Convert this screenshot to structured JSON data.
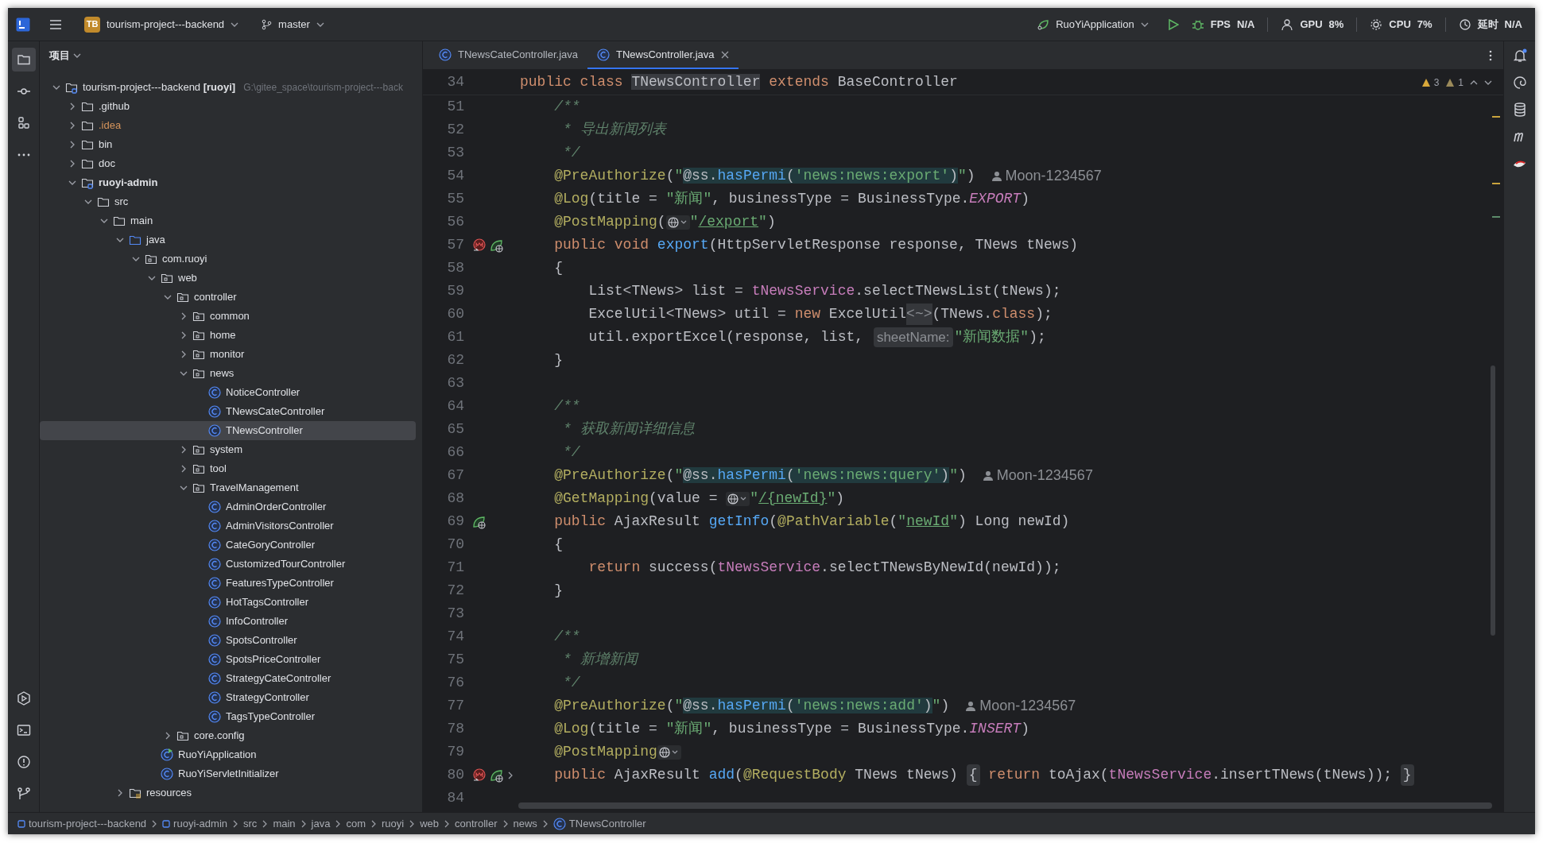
{
  "title_bar": {
    "project": {
      "badge": "TB",
      "name": "tourism-project---backend"
    },
    "branch": "master",
    "run_config": "RuoYiApplication",
    "monitors": [
      {
        "kind": "fps",
        "label": "FPS",
        "value": "N/A"
      },
      {
        "kind": "gpu",
        "label": "GPU",
        "value": "8%"
      },
      {
        "kind": "cpu",
        "label": "CPU",
        "value": "7%"
      },
      {
        "kind": "latency",
        "label": "延时",
        "value": "N/A"
      }
    ]
  },
  "tool_strip": {
    "top": [
      {
        "kind": "project",
        "selected": true
      },
      {
        "kind": "commit",
        "selected": false
      },
      {
        "kind": "structure",
        "selected": false
      },
      {
        "kind": "more",
        "selected": false
      }
    ],
    "bottom": [
      {
        "kind": "services",
        "selected": false
      },
      {
        "kind": "terminal",
        "selected": false
      },
      {
        "kind": "problems",
        "selected": false
      },
      {
        "kind": "git",
        "selected": false
      }
    ]
  },
  "project_panel": {
    "title": "项目",
    "tree": [
      {
        "label": "tourism-project---backend",
        "module": "[ruoyi]",
        "path": "G:\\gitee_space\\tourism-project---back",
        "kind": "module",
        "expanded": true,
        "selected": false,
        "children": [
          {
            "label": ".github",
            "kind": "folder",
            "expanded": false,
            "selected": false
          },
          {
            "label": ".idea",
            "kind": "ignored-folder",
            "expanded": false,
            "selected": false
          },
          {
            "label": "bin",
            "kind": "folder",
            "expanded": false,
            "selected": false
          },
          {
            "label": "doc",
            "kind": "folder",
            "expanded": false,
            "selected": false
          },
          {
            "label": "ruoyi-admin",
            "kind": "module",
            "expanded": true,
            "selected": false,
            "children": [
              {
                "label": "src",
                "kind": "folder",
                "expanded": true,
                "selected": false,
                "children": [
                  {
                    "label": "main",
                    "kind": "folder",
                    "expanded": true,
                    "selected": false,
                    "children": [
                      {
                        "label": "java",
                        "kind": "source",
                        "expanded": true,
                        "selected": false,
                        "children": [
                          {
                            "label": "com.ruoyi",
                            "kind": "package",
                            "expanded": true,
                            "selected": false,
                            "children": [
                              {
                                "label": "web",
                                "kind": "package",
                                "expanded": true,
                                "selected": false,
                                "children": [
                                  {
                                    "label": "controller",
                                    "kind": "package",
                                    "expanded": true,
                                    "selected": false,
                                    "children": [
                                      {
                                        "label": "common",
                                        "kind": "package",
                                        "expanded": false,
                                        "selected": false
                                      },
                                      {
                                        "label": "home",
                                        "kind": "package",
                                        "expanded": false,
                                        "selected": false
                                      },
                                      {
                                        "label": "monitor",
                                        "kind": "package",
                                        "expanded": false,
                                        "selected": false
                                      },
                                      {
                                        "label": "news",
                                        "kind": "package",
                                        "expanded": true,
                                        "selected": false,
                                        "children": [
                                          {
                                            "label": "NoticeController",
                                            "kind": "class",
                                            "selected": false
                                          },
                                          {
                                            "label": "TNewsCateController",
                                            "kind": "class",
                                            "selected": false
                                          },
                                          {
                                            "label": "TNewsController",
                                            "kind": "class",
                                            "selected": true
                                          }
                                        ]
                                      },
                                      {
                                        "label": "system",
                                        "kind": "package",
                                        "expanded": false,
                                        "selected": false
                                      },
                                      {
                                        "label": "tool",
                                        "kind": "package",
                                        "expanded": false,
                                        "selected": false
                                      },
                                      {
                                        "label": "TravelManagement",
                                        "kind": "package",
                                        "expanded": true,
                                        "selected": false,
                                        "children": [
                                          {
                                            "label": "AdminOrderController",
                                            "kind": "class",
                                            "selected": false
                                          },
                                          {
                                            "label": "AdminVisitorsController",
                                            "kind": "class",
                                            "selected": false
                                          },
                                          {
                                            "label": "CateGoryController",
                                            "kind": "class",
                                            "selected": false
                                          },
                                          {
                                            "label": "CustomizedTourController",
                                            "kind": "class",
                                            "selected": false
                                          },
                                          {
                                            "label": "FeaturesTypeController",
                                            "kind": "class",
                                            "selected": false
                                          },
                                          {
                                            "label": "HotTagsController",
                                            "kind": "class",
                                            "selected": false
                                          },
                                          {
                                            "label": "InfoController",
                                            "kind": "class",
                                            "selected": false
                                          },
                                          {
                                            "label": "SpotsController",
                                            "kind": "class",
                                            "selected": false
                                          },
                                          {
                                            "label": "SpotsPriceController",
                                            "kind": "class",
                                            "selected": false
                                          },
                                          {
                                            "label": "StrategyCateController",
                                            "kind": "class",
                                            "selected": false
                                          },
                                          {
                                            "label": "StrategyController",
                                            "kind": "class",
                                            "selected": false
                                          },
                                          {
                                            "label": "TagsTypeController",
                                            "kind": "class",
                                            "selected": false
                                          }
                                        ]
                                      }
                                    ]
                                  },
                                  {
                                    "label": "core.config",
                                    "kind": "package",
                                    "expanded": false,
                                    "selected": false
                                  }
                                ]
                              },
                              {
                                "label": "RuoYiApplication",
                                "kind": "app",
                                "selected": false
                              },
                              {
                                "label": "RuoYiServletInitializer",
                                "kind": "class",
                                "selected": false
                              }
                            ]
                          }
                        ]
                      },
                      {
                        "label": "resources",
                        "kind": "resources",
                        "expanded": false,
                        "selected": false
                      }
                    ]
                  }
                ]
              }
            ]
          }
        ]
      }
    ]
  },
  "editor": {
    "tabs": [
      {
        "label": "TNewsCateController.java",
        "selected": false
      },
      {
        "label": "TNewsController.java",
        "selected": true
      }
    ],
    "inspections": {
      "warnings": "3",
      "weak_warnings": "1"
    },
    "sticky_line": {
      "number": "34",
      "tokens": [
        {
          "kind": "keyword",
          "text": "public class "
        },
        {
          "kind": "class-highlight",
          "text": "TNewsController"
        },
        {
          "kind": "keyword",
          "text": " extends "
        },
        {
          "kind": "plain",
          "text": "BaseController"
        }
      ]
    },
    "lines": [
      {
        "number": "51",
        "tokens": [
          {
            "kind": "doc",
            "text": "    /**"
          }
        ]
      },
      {
        "number": "52",
        "tokens": [
          {
            "kind": "doc",
            "text": "     * 导出新闻列表"
          }
        ]
      },
      {
        "number": "53",
        "tokens": [
          {
            "kind": "doc",
            "text": "     */"
          }
        ]
      },
      {
        "number": "54",
        "tokens": [
          {
            "kind": "annotation",
            "text": "    @PreAuthorize"
          },
          {
            "kind": "plain",
            "text": "("
          },
          {
            "kind": "string",
            "text": "\""
          },
          {
            "kind": "injection",
            "tokens": [
              {
                "kind": "plain",
                "text": "@ss."
              },
              {
                "kind": "method",
                "text": "hasPermi"
              },
              {
                "kind": "plain",
                "text": "("
              },
              {
                "kind": "string",
                "text": "'news:news:export'"
              },
              {
                "kind": "plain",
                "text": ")"
              }
            ]
          },
          {
            "kind": "string",
            "text": "\""
          },
          {
            "kind": "plain",
            "text": ")"
          },
          {
            "kind": "author",
            "text": "Moon-1234567"
          }
        ]
      },
      {
        "number": "55",
        "tokens": [
          {
            "kind": "annotation",
            "text": "    @Log"
          },
          {
            "kind": "plain",
            "text": "(title = "
          },
          {
            "kind": "string",
            "text": "\"新闻\""
          },
          {
            "kind": "plain",
            "text": ", businessType = BusinessType."
          },
          {
            "kind": "constant",
            "text": "EXPORT"
          },
          {
            "kind": "plain",
            "text": ")"
          }
        ]
      },
      {
        "number": "56",
        "tokens": [
          {
            "kind": "annotation",
            "text": "    @PostMapping"
          },
          {
            "kind": "plain",
            "text": "("
          },
          {
            "kind": "globe"
          },
          {
            "kind": "string",
            "text": "\""
          },
          {
            "kind": "url",
            "text": "/export"
          },
          {
            "kind": "string",
            "text": "\""
          },
          {
            "kind": "plain",
            "text": ")"
          }
        ]
      },
      {
        "number": "57",
        "gutter": [
          {
            "kind": "method"
          },
          {
            "kind": "endpoint"
          }
        ],
        "tokens": [
          {
            "kind": "keyword",
            "text": "    public void "
          },
          {
            "kind": "decl",
            "text": "export"
          },
          {
            "kind": "plain",
            "text": "(HttpServletResponse response, TNews tNews)"
          }
        ]
      },
      {
        "number": "58",
        "tokens": [
          {
            "kind": "plain",
            "text": "    {"
          }
        ]
      },
      {
        "number": "59",
        "tokens": [
          {
            "kind": "plain",
            "text": "        List<TNews> list = "
          },
          {
            "kind": "field",
            "text": "tNewsService"
          },
          {
            "kind": "plain",
            "text": ".selectTNewsList(tNews);"
          }
        ]
      },
      {
        "number": "60",
        "tokens": [
          {
            "kind": "plain",
            "text": "        ExcelUtil<TNews> util = "
          },
          {
            "kind": "keyword",
            "text": "new"
          },
          {
            "kind": "plain",
            "text": " ExcelUtil"
          },
          {
            "kind": "hint",
            "text": "<~>"
          },
          {
            "kind": "plain",
            "text": "(TNews."
          },
          {
            "kind": "keyword",
            "text": "class"
          },
          {
            "kind": "plain",
            "text": ");"
          }
        ]
      },
      {
        "number": "61",
        "tokens": [
          {
            "kind": "plain",
            "text": "        util.exportExcel(response, list, "
          },
          {
            "kind": "param",
            "text": "sheetName:"
          },
          {
            "kind": "string",
            "text": "\"新闻数据\""
          },
          {
            "kind": "plain",
            "text": ");"
          }
        ]
      },
      {
        "number": "62",
        "tokens": [
          {
            "kind": "plain",
            "text": "    }"
          }
        ]
      },
      {
        "number": "63"
      },
      {
        "number": "64",
        "tokens": [
          {
            "kind": "doc",
            "text": "    /**"
          }
        ]
      },
      {
        "number": "65",
        "tokens": [
          {
            "kind": "doc",
            "text": "     * 获取新闻详细信息"
          }
        ]
      },
      {
        "number": "66",
        "tokens": [
          {
            "kind": "doc",
            "text": "     */"
          }
        ]
      },
      {
        "number": "67",
        "tokens": [
          {
            "kind": "annotation",
            "text": "    @PreAuthorize"
          },
          {
            "kind": "plain",
            "text": "("
          },
          {
            "kind": "string",
            "text": "\""
          },
          {
            "kind": "injection",
            "tokens": [
              {
                "kind": "plain",
                "text": "@ss."
              },
              {
                "kind": "method",
                "text": "hasPermi"
              },
              {
                "kind": "plain",
                "text": "("
              },
              {
                "kind": "string",
                "text": "'news:news:query'"
              },
              {
                "kind": "plain",
                "text": ")"
              }
            ]
          },
          {
            "kind": "string",
            "text": "\""
          },
          {
            "kind": "plain",
            "text": ")"
          },
          {
            "kind": "author",
            "text": "Moon-1234567"
          }
        ]
      },
      {
        "number": "68",
        "tokens": [
          {
            "kind": "annotation",
            "text": "    @GetMapping"
          },
          {
            "kind": "plain",
            "text": "(value = "
          },
          {
            "kind": "globe"
          },
          {
            "kind": "string",
            "text": "\""
          },
          {
            "kind": "url",
            "text": "/{newId}"
          },
          {
            "kind": "string",
            "text": "\""
          },
          {
            "kind": "plain",
            "text": ")"
          }
        ]
      },
      {
        "number": "69",
        "gutter": [
          {
            "kind": "endpoint"
          }
        ],
        "tokens": [
          {
            "kind": "keyword",
            "text": "    public "
          },
          {
            "kind": "plain",
            "text": "AjaxResult "
          },
          {
            "kind": "decl",
            "text": "getInfo"
          },
          {
            "kind": "plain",
            "text": "("
          },
          {
            "kind": "annotation",
            "text": "@PathVariable"
          },
          {
            "kind": "plain",
            "text": "("
          },
          {
            "kind": "string",
            "text": "\""
          },
          {
            "kind": "url",
            "text": "newId"
          },
          {
            "kind": "string",
            "text": "\""
          },
          {
            "kind": "plain",
            "text": ") Long newId)"
          }
        ]
      },
      {
        "number": "70",
        "tokens": [
          {
            "kind": "plain",
            "text": "    {"
          }
        ]
      },
      {
        "number": "71",
        "tokens": [
          {
            "kind": "keyword",
            "text": "        return "
          },
          {
            "kind": "plain",
            "text": "success("
          },
          {
            "kind": "field",
            "text": "tNewsService"
          },
          {
            "kind": "plain",
            "text": ".selectTNewsByNewId(newId));"
          }
        ]
      },
      {
        "number": "72",
        "tokens": [
          {
            "kind": "plain",
            "text": "    }"
          }
        ]
      },
      {
        "number": "73"
      },
      {
        "number": "74",
        "tokens": [
          {
            "kind": "doc",
            "text": "    /**"
          }
        ]
      },
      {
        "number": "75",
        "tokens": [
          {
            "kind": "doc",
            "text": "     * 新增新闻"
          }
        ]
      },
      {
        "number": "76",
        "tokens": [
          {
            "kind": "doc",
            "text": "     */"
          }
        ]
      },
      {
        "number": "77",
        "tokens": [
          {
            "kind": "annotation",
            "text": "    @PreAuthorize"
          },
          {
            "kind": "plain",
            "text": "("
          },
          {
            "kind": "string",
            "text": "\""
          },
          {
            "kind": "injection",
            "tokens": [
              {
                "kind": "plain",
                "text": "@ss."
              },
              {
                "kind": "method",
                "text": "hasPermi"
              },
              {
                "kind": "plain",
                "text": "("
              },
              {
                "kind": "string",
                "text": "'news:news:add'"
              },
              {
                "kind": "plain",
                "text": ")"
              }
            ]
          },
          {
            "kind": "string",
            "text": "\""
          },
          {
            "kind": "plain",
            "text": ")"
          },
          {
            "kind": "author",
            "text": "Moon-1234567"
          }
        ]
      },
      {
        "number": "78",
        "tokens": [
          {
            "kind": "annotation",
            "text": "    @Log"
          },
          {
            "kind": "plain",
            "text": "(title = "
          },
          {
            "kind": "string",
            "text": "\"新闻\""
          },
          {
            "kind": "plain",
            "text": ", businessType = BusinessType."
          },
          {
            "kind": "constant",
            "text": "INSERT"
          },
          {
            "kind": "plain",
            "text": ")"
          }
        ]
      },
      {
        "number": "79",
        "tokens": [
          {
            "kind": "annotation",
            "text": "    @PostMapping"
          },
          {
            "kind": "globe"
          }
        ]
      },
      {
        "number": "80",
        "gutter": [
          {
            "kind": "method"
          },
          {
            "kind": "endpoint"
          },
          {
            "kind": "fold"
          }
        ],
        "tokens": [
          {
            "kind": "keyword",
            "text": "    public "
          },
          {
            "kind": "plain",
            "text": "AjaxResult "
          },
          {
            "kind": "decl",
            "text": "add"
          },
          {
            "kind": "plain",
            "text": "("
          },
          {
            "kind": "annotation",
            "text": "@RequestBody"
          },
          {
            "kind": "plain",
            "text": " TNews tNews) "
          },
          {
            "kind": "fold",
            "text": "{"
          },
          {
            "kind": "keyword",
            "text": " return"
          },
          {
            "kind": "plain",
            "text": " toAjax("
          },
          {
            "kind": "field",
            "text": "tNewsService"
          },
          {
            "kind": "plain",
            "text": ".insertTNews(tNews)); "
          },
          {
            "kind": "fold",
            "text": "}"
          }
        ]
      },
      {
        "number": "84"
      }
    ]
  },
  "breadcrumbs": [
    {
      "label": "tourism-project---backend",
      "kind": "module"
    },
    {
      "label": "ruoyi-admin",
      "kind": "module"
    },
    {
      "label": "src",
      "kind": "folder"
    },
    {
      "label": "main",
      "kind": "folder"
    },
    {
      "label": "java",
      "kind": "folder"
    },
    {
      "label": "com",
      "kind": "folder"
    },
    {
      "label": "ruoyi",
      "kind": "folder"
    },
    {
      "label": "web",
      "kind": "folder"
    },
    {
      "label": "controller",
      "kind": "folder"
    },
    {
      "label": "news",
      "kind": "folder"
    },
    {
      "label": "TNewsController",
      "kind": "class"
    }
  ]
}
